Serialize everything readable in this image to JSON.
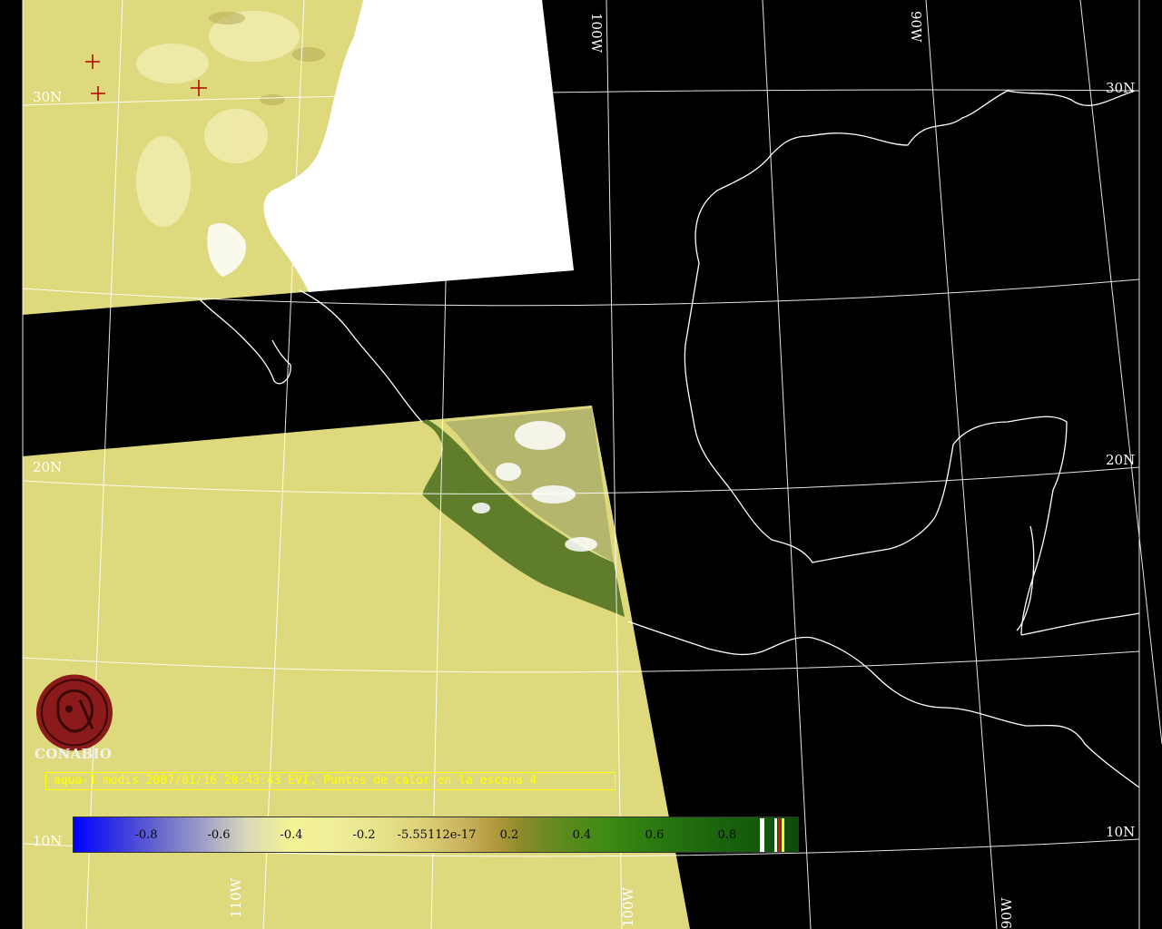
{
  "map": {
    "grid_labels": {
      "lat_30_left": "30N",
      "lat_30_right": "30N",
      "lat_20_left": "20N",
      "lat_20_right": "20N",
      "lat_10_left": "10N",
      "lat_10_right": "10N",
      "lon_100_top": "100W",
      "lon_90_top": "90W",
      "lon_110_bottom": "110W",
      "lon_100_bottom": "100W",
      "lon_90_bottom": "90W"
    },
    "colors": {
      "background": "#000000",
      "land_khaki": "#dfd97e",
      "cloud": "#ffffff",
      "coastline": "#ffffff",
      "graticule": "#ffffff",
      "hotspot_marker": "#b00000",
      "caption": "#ffff00",
      "logo": "#8b1a1a"
    },
    "hotspots_count": 3
  },
  "logo": {
    "text": "CONABIO"
  },
  "caption": {
    "text": "aqua-1 modis 2007/01/16 20:43:43 EVI, Puntos de calor en la escena 4"
  },
  "colorbar": {
    "ticks": [
      "-0.8",
      "-0.6",
      "-0.4",
      "-0.2",
      "-5.55112e-17",
      "0.2",
      "0.4",
      "0.6",
      "0.8"
    ],
    "range": [
      -1,
      1
    ],
    "extra_swatches": [
      "#ffffff",
      "#ffffff",
      "#ff0000",
      "#ffff00"
    ]
  }
}
